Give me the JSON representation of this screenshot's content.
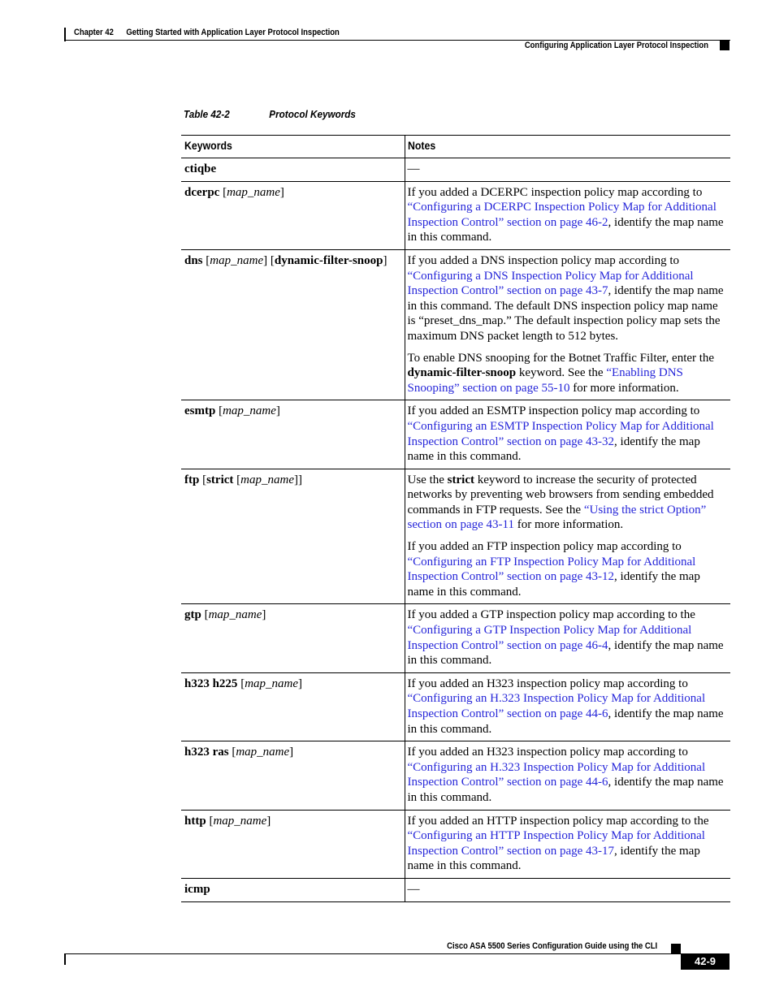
{
  "header": {
    "chapter_label": "Chapter 42",
    "chapter_title": "Getting Started with Application Layer Protocol Inspection",
    "section_title": "Configuring Application Layer Protocol Inspection"
  },
  "table": {
    "caption_number": "Table 42-2",
    "caption_title": "Protocol Keywords",
    "columns": [
      "Keywords",
      "Notes"
    ],
    "rows": [
      {
        "keyword": [
          {
            "t": "ctiqbe",
            "s": "b"
          }
        ],
        "notes": [
          [
            {
              "t": "—"
            }
          ]
        ]
      },
      {
        "keyword": [
          {
            "t": "dcerpc",
            "s": "b"
          },
          {
            "t": " ["
          },
          {
            "t": "map_name",
            "s": "i"
          },
          {
            "t": "]"
          }
        ],
        "notes": [
          [
            {
              "t": "If you added a DCERPC inspection policy map according to "
            },
            {
              "t": "“Configuring a DCERPC Inspection Policy Map for Additional Inspection Control” section on page 46-2",
              "s": "link"
            },
            {
              "t": ", identify the map name in this command."
            }
          ]
        ]
      },
      {
        "keyword": [
          {
            "t": "dns",
            "s": "b"
          },
          {
            "t": " ["
          },
          {
            "t": "map_name",
            "s": "i"
          },
          {
            "t": "] ["
          },
          {
            "t": "dynamic-filter-snoop",
            "s": "b"
          },
          {
            "t": "]"
          }
        ],
        "notes": [
          [
            {
              "t": "If you added a DNS inspection policy map according to "
            },
            {
              "t": "“Configuring a DNS Inspection Policy Map for Additional Inspection Control” section on page 43-7",
              "s": "link"
            },
            {
              "t": ", identify the map name in this command. The default DNS inspection policy map name is “preset_dns_map.” The default inspection policy map sets the maximum DNS packet length to 512 bytes."
            }
          ],
          [
            {
              "t": "To enable DNS snooping for the Botnet Traffic Filter, enter the "
            },
            {
              "t": "dynamic-filter-snoop",
              "s": "b"
            },
            {
              "t": " keyword. See the "
            },
            {
              "t": "“Enabling DNS Snooping” section on page 55-10",
              "s": "link"
            },
            {
              "t": " for more information."
            }
          ]
        ]
      },
      {
        "keyword": [
          {
            "t": "esmtp",
            "s": "b"
          },
          {
            "t": " ["
          },
          {
            "t": "map_name",
            "s": "i"
          },
          {
            "t": "]"
          }
        ],
        "notes": [
          [
            {
              "t": "If you added an ESMTP inspection policy map according to "
            },
            {
              "t": "“Configuring an ESMTP Inspection Policy Map for Additional Inspection Control” section on page 43-32",
              "s": "link"
            },
            {
              "t": ", identify the map name in this command."
            }
          ]
        ]
      },
      {
        "keyword": [
          {
            "t": "ftp",
            "s": "b"
          },
          {
            "t": " ["
          },
          {
            "t": "strict",
            "s": "b"
          },
          {
            "t": " ["
          },
          {
            "t": "map_name",
            "s": "i"
          },
          {
            "t": "]]"
          }
        ],
        "notes": [
          [
            {
              "t": "Use the "
            },
            {
              "t": "strict",
              "s": "b"
            },
            {
              "t": " keyword to increase the security of protected networks by preventing web browsers from sending embedded commands in FTP requests. See the "
            },
            {
              "t": "“Using the strict Option” section on page 43-11",
              "s": "link"
            },
            {
              "t": " for more information."
            }
          ],
          [
            {
              "t": "If you added an FTP inspection policy map according to "
            },
            {
              "t": "“Configuring an FTP Inspection Policy Map for Additional Inspection Control” section on page 43-12",
              "s": "link"
            },
            {
              "t": ", identify the map name in this command."
            }
          ]
        ]
      },
      {
        "keyword": [
          {
            "t": "gtp",
            "s": "b"
          },
          {
            "t": " ["
          },
          {
            "t": "map_name",
            "s": "i"
          },
          {
            "t": "]"
          }
        ],
        "notes": [
          [
            {
              "t": "If you added a GTP inspection policy map according to the "
            },
            {
              "t": "“Configuring a GTP Inspection Policy Map for Additional Inspection Control” section on page 46-4",
              "s": "link"
            },
            {
              "t": ", identify the map name in this command."
            }
          ]
        ]
      },
      {
        "keyword": [
          {
            "t": "h323 h225",
            "s": "b"
          },
          {
            "t": " ["
          },
          {
            "t": "map_name",
            "s": "i"
          },
          {
            "t": "]"
          }
        ],
        "notes": [
          [
            {
              "t": "If you added an H323 inspection policy map according to "
            },
            {
              "t": "“Configuring an H.323 Inspection Policy Map for Additional Inspection Control” section on page 44-6",
              "s": "link"
            },
            {
              "t": ", identify the map name in this command."
            }
          ]
        ]
      },
      {
        "keyword": [
          {
            "t": "h323 ras",
            "s": "b"
          },
          {
            "t": " ["
          },
          {
            "t": "map_name",
            "s": "i"
          },
          {
            "t": "]"
          }
        ],
        "notes": [
          [
            {
              "t": "If you added an H323 inspection policy map according to "
            },
            {
              "t": "“Configuring an H.323 Inspection Policy Map for Additional Inspection Control” section on page 44-6",
              "s": "link"
            },
            {
              "t": ", identify the map name in this command."
            }
          ]
        ]
      },
      {
        "keyword": [
          {
            "t": "http",
            "s": "b"
          },
          {
            "t": " ["
          },
          {
            "t": "map_name",
            "s": "i"
          },
          {
            "t": "]"
          }
        ],
        "notes": [
          [
            {
              "t": "If you added an HTTP inspection policy map according to the "
            },
            {
              "t": "“Configuring an HTTP Inspection Policy Map for Additional Inspection Control” section on page 43-17",
              "s": "link"
            },
            {
              "t": ", identify the map name in this command."
            }
          ]
        ]
      },
      {
        "keyword": [
          {
            "t": "icmp",
            "s": "b"
          }
        ],
        "notes": [
          [
            {
              "t": "—"
            }
          ]
        ]
      }
    ]
  },
  "footer": {
    "book_title": "Cisco ASA 5500 Series Configuration Guide using the CLI",
    "page_number": "42-9"
  },
  "colors": {
    "link": "#2626d9",
    "text": "#000000"
  }
}
